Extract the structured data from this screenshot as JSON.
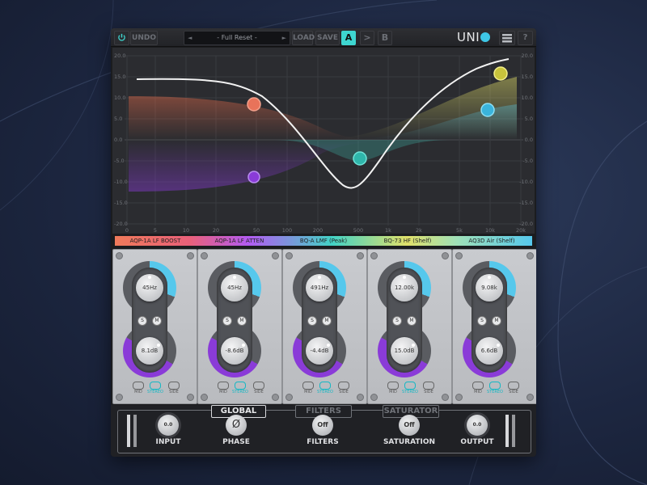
{
  "toolbar": {
    "power_icon": "power-icon",
    "undo_label": "UNDO",
    "preset_name": "- Full Reset -",
    "prev_arrow": "◄",
    "next_arrow": "►",
    "load_label": "LOAD",
    "save_label": "SAVE",
    "ab_a_label": "A",
    "ab_copy_label": ">",
    "ab_b_label": "B",
    "logo_text": "UNI",
    "menu_icon": "menu-icon",
    "help_label": "?"
  },
  "graph": {
    "y_labels": [
      "20.0",
      "15.0",
      "10.0",
      "5.0",
      "0.0",
      "-5.0",
      "-10.0",
      "-15.0",
      "-20.0"
    ],
    "x_labels": [
      "0",
      "5",
      "10",
      "20",
      "50",
      "100",
      "200",
      "500",
      "1k",
      "2k",
      "5k",
      "10k",
      "20k"
    ]
  },
  "bands": [
    {
      "label": "AQP-1A LF BOOST",
      "color": "#f07a5a",
      "freq": "45Hz",
      "gain": "8.1dB"
    },
    {
      "label": "AQP-1A LF ATTEN",
      "color": "#b35bf2",
      "freq": "45Hz",
      "gain": "-8.6dB"
    },
    {
      "label": "BQ-A LMF (Peak)",
      "color": "#42d2c5",
      "freq": "491Hz",
      "gain": "-4.4dB"
    },
    {
      "label": "BQ-73 HF (Shelf)",
      "color": "#e0e06a",
      "freq": "12.00k",
      "gain": "15.0dB"
    },
    {
      "label": "AQ3D Air (Shelf)",
      "color": "#56c8ec",
      "freq": "9.08k",
      "gain": "6.6dB"
    }
  ],
  "module_common": {
    "solo_label": "S",
    "mute_label": "M",
    "mode_mid": "MID",
    "mode_stereo": "STEREO",
    "mode_side": "SIDE"
  },
  "bottom": {
    "global_tab": "GLOBAL",
    "filters_tab": "FILTERS",
    "saturator_tab": "SATURATOR",
    "input_label": "INPUT",
    "input_value": "0.0",
    "phase_label": "PHASE",
    "phase_symbol": "Ø",
    "filters_label": "FILTERS",
    "filters_value": "Off",
    "saturation_label": "SATURATION",
    "saturation_value": "Off",
    "output_label": "OUTPUT",
    "output_value": "0.0"
  }
}
